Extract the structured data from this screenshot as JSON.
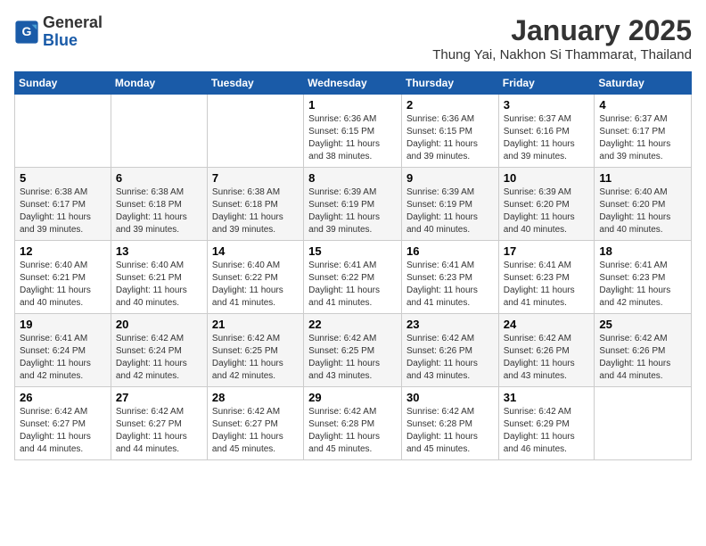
{
  "header": {
    "logo_line1": "General",
    "logo_line2": "Blue",
    "title": "January 2025",
    "subtitle": "Thung Yai, Nakhon Si Thammarat, Thailand"
  },
  "calendar": {
    "headers": [
      "Sunday",
      "Monday",
      "Tuesday",
      "Wednesday",
      "Thursday",
      "Friday",
      "Saturday"
    ],
    "weeks": [
      [
        {
          "day": "",
          "info": ""
        },
        {
          "day": "",
          "info": ""
        },
        {
          "day": "",
          "info": ""
        },
        {
          "day": "1",
          "info": "Sunrise: 6:36 AM\nSunset: 6:15 PM\nDaylight: 11 hours\nand 38 minutes."
        },
        {
          "day": "2",
          "info": "Sunrise: 6:36 AM\nSunset: 6:15 PM\nDaylight: 11 hours\nand 39 minutes."
        },
        {
          "day": "3",
          "info": "Sunrise: 6:37 AM\nSunset: 6:16 PM\nDaylight: 11 hours\nand 39 minutes."
        },
        {
          "day": "4",
          "info": "Sunrise: 6:37 AM\nSunset: 6:17 PM\nDaylight: 11 hours\nand 39 minutes."
        }
      ],
      [
        {
          "day": "5",
          "info": "Sunrise: 6:38 AM\nSunset: 6:17 PM\nDaylight: 11 hours\nand 39 minutes."
        },
        {
          "day": "6",
          "info": "Sunrise: 6:38 AM\nSunset: 6:18 PM\nDaylight: 11 hours\nand 39 minutes."
        },
        {
          "day": "7",
          "info": "Sunrise: 6:38 AM\nSunset: 6:18 PM\nDaylight: 11 hours\nand 39 minutes."
        },
        {
          "day": "8",
          "info": "Sunrise: 6:39 AM\nSunset: 6:19 PM\nDaylight: 11 hours\nand 39 minutes."
        },
        {
          "day": "9",
          "info": "Sunrise: 6:39 AM\nSunset: 6:19 PM\nDaylight: 11 hours\nand 40 minutes."
        },
        {
          "day": "10",
          "info": "Sunrise: 6:39 AM\nSunset: 6:20 PM\nDaylight: 11 hours\nand 40 minutes."
        },
        {
          "day": "11",
          "info": "Sunrise: 6:40 AM\nSunset: 6:20 PM\nDaylight: 11 hours\nand 40 minutes."
        }
      ],
      [
        {
          "day": "12",
          "info": "Sunrise: 6:40 AM\nSunset: 6:21 PM\nDaylight: 11 hours\nand 40 minutes."
        },
        {
          "day": "13",
          "info": "Sunrise: 6:40 AM\nSunset: 6:21 PM\nDaylight: 11 hours\nand 40 minutes."
        },
        {
          "day": "14",
          "info": "Sunrise: 6:40 AM\nSunset: 6:22 PM\nDaylight: 11 hours\nand 41 minutes."
        },
        {
          "day": "15",
          "info": "Sunrise: 6:41 AM\nSunset: 6:22 PM\nDaylight: 11 hours\nand 41 minutes."
        },
        {
          "day": "16",
          "info": "Sunrise: 6:41 AM\nSunset: 6:23 PM\nDaylight: 11 hours\nand 41 minutes."
        },
        {
          "day": "17",
          "info": "Sunrise: 6:41 AM\nSunset: 6:23 PM\nDaylight: 11 hours\nand 41 minutes."
        },
        {
          "day": "18",
          "info": "Sunrise: 6:41 AM\nSunset: 6:23 PM\nDaylight: 11 hours\nand 42 minutes."
        }
      ],
      [
        {
          "day": "19",
          "info": "Sunrise: 6:41 AM\nSunset: 6:24 PM\nDaylight: 11 hours\nand 42 minutes."
        },
        {
          "day": "20",
          "info": "Sunrise: 6:42 AM\nSunset: 6:24 PM\nDaylight: 11 hours\nand 42 minutes."
        },
        {
          "day": "21",
          "info": "Sunrise: 6:42 AM\nSunset: 6:25 PM\nDaylight: 11 hours\nand 42 minutes."
        },
        {
          "day": "22",
          "info": "Sunrise: 6:42 AM\nSunset: 6:25 PM\nDaylight: 11 hours\nand 43 minutes."
        },
        {
          "day": "23",
          "info": "Sunrise: 6:42 AM\nSunset: 6:26 PM\nDaylight: 11 hours\nand 43 minutes."
        },
        {
          "day": "24",
          "info": "Sunrise: 6:42 AM\nSunset: 6:26 PM\nDaylight: 11 hours\nand 43 minutes."
        },
        {
          "day": "25",
          "info": "Sunrise: 6:42 AM\nSunset: 6:26 PM\nDaylight: 11 hours\nand 44 minutes."
        }
      ],
      [
        {
          "day": "26",
          "info": "Sunrise: 6:42 AM\nSunset: 6:27 PM\nDaylight: 11 hours\nand 44 minutes."
        },
        {
          "day": "27",
          "info": "Sunrise: 6:42 AM\nSunset: 6:27 PM\nDaylight: 11 hours\nand 44 minutes."
        },
        {
          "day": "28",
          "info": "Sunrise: 6:42 AM\nSunset: 6:27 PM\nDaylight: 11 hours\nand 45 minutes."
        },
        {
          "day": "29",
          "info": "Sunrise: 6:42 AM\nSunset: 6:28 PM\nDaylight: 11 hours\nand 45 minutes."
        },
        {
          "day": "30",
          "info": "Sunrise: 6:42 AM\nSunset: 6:28 PM\nDaylight: 11 hours\nand 45 minutes."
        },
        {
          "day": "31",
          "info": "Sunrise: 6:42 AM\nSunset: 6:29 PM\nDaylight: 11 hours\nand 46 minutes."
        },
        {
          "day": "",
          "info": ""
        }
      ]
    ]
  }
}
